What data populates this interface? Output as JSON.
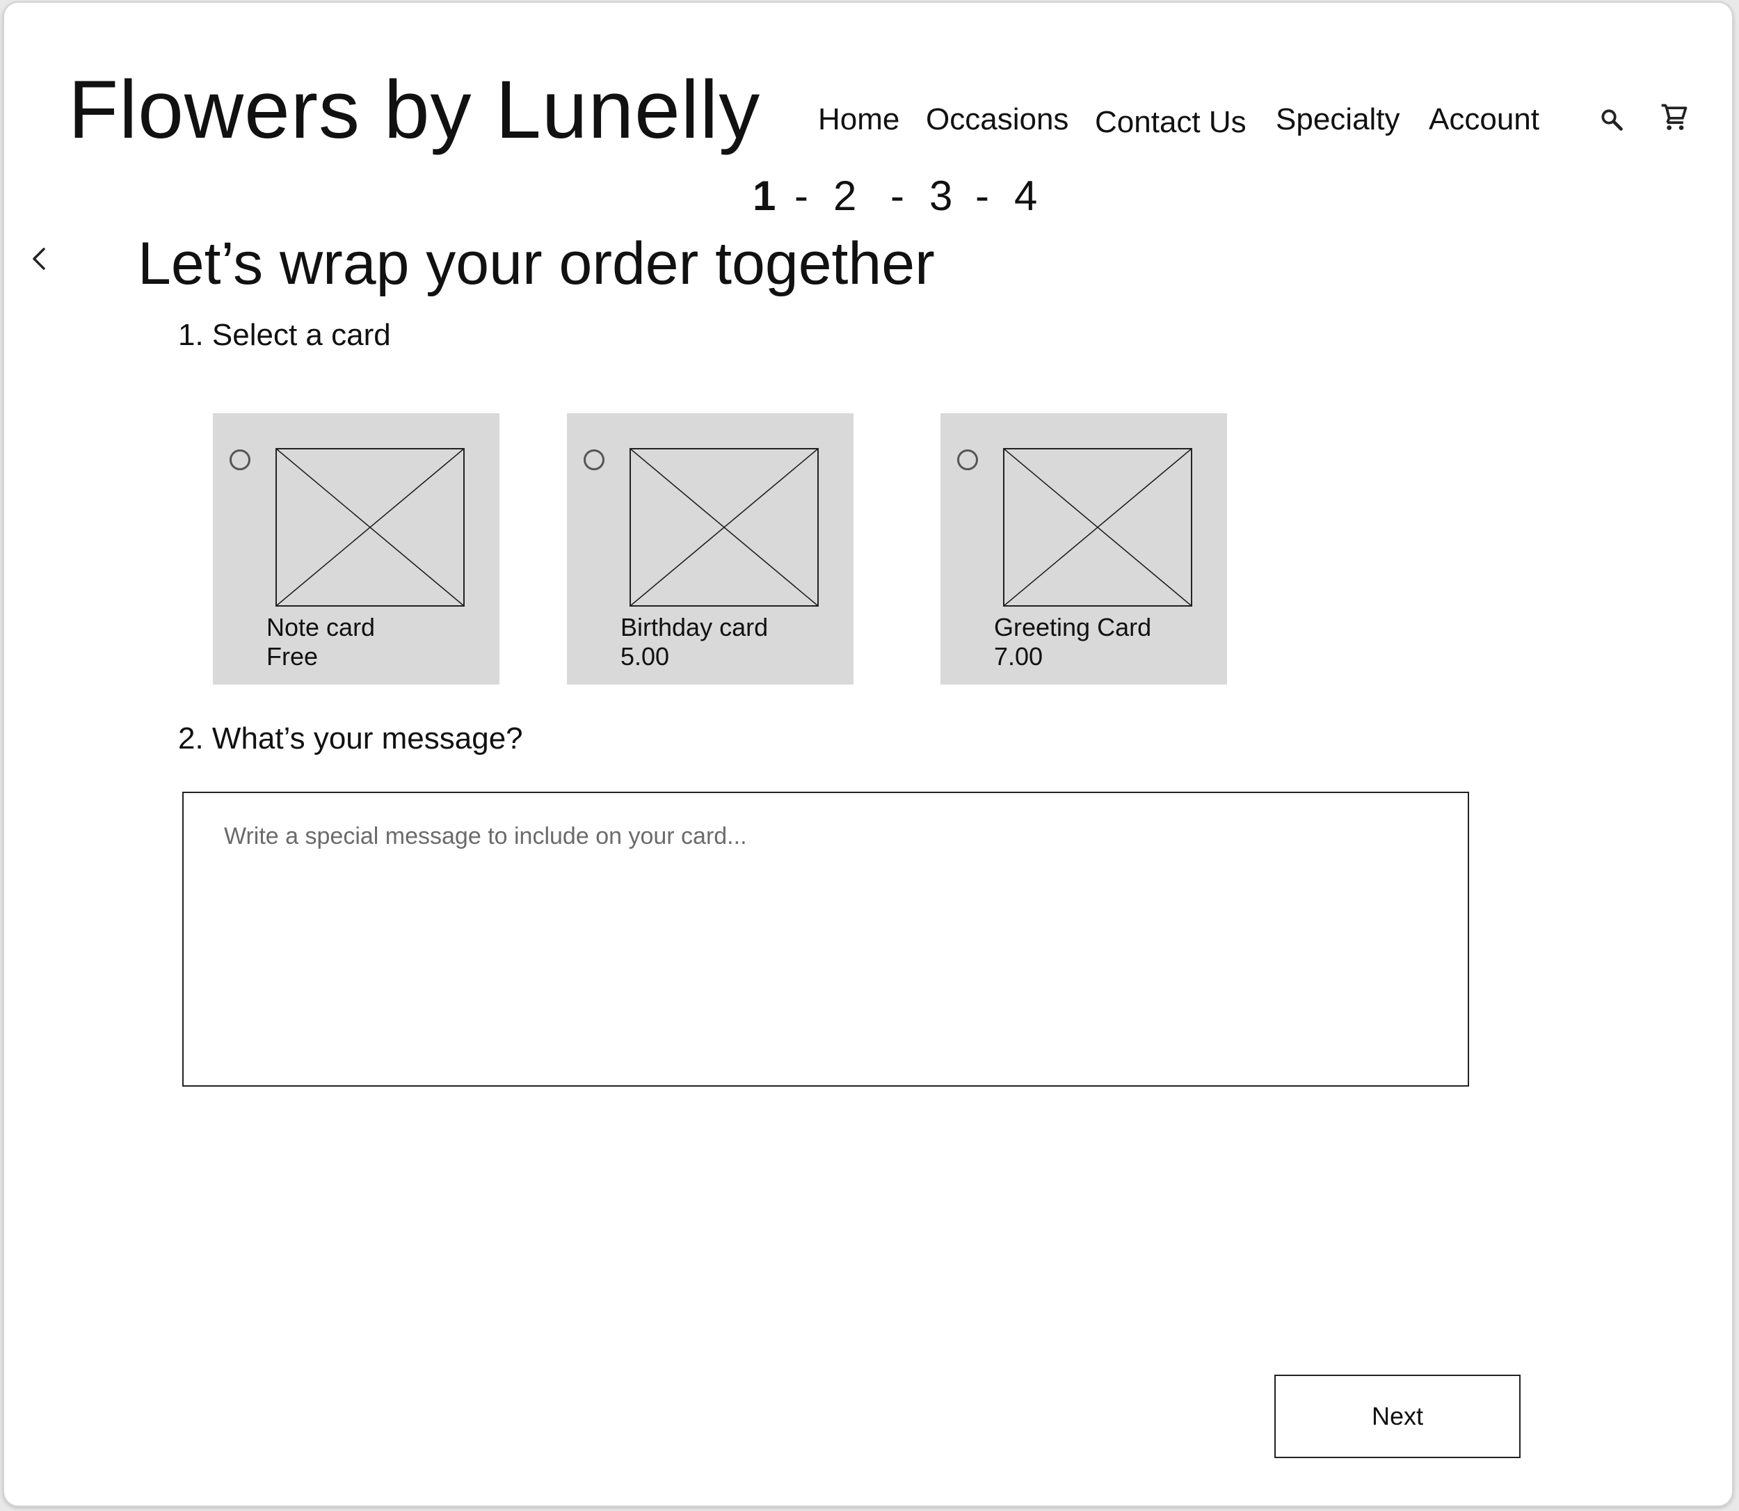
{
  "brand": {
    "title": "Flowers by Lunelly"
  },
  "nav": {
    "items": [
      {
        "label": "Home"
      },
      {
        "label": "Occasions"
      },
      {
        "label": "Contact Us"
      },
      {
        "label": "Specialty"
      },
      {
        "label": "Account"
      }
    ],
    "icons": [
      "search-icon",
      "cart-icon"
    ]
  },
  "progress": {
    "steps": [
      "1",
      "2",
      "3",
      "4"
    ],
    "separator": "-",
    "current_step": 1
  },
  "page": {
    "title": "Let’s wrap your order together"
  },
  "sections": {
    "select_card": {
      "label": "1. Select a card"
    },
    "message": {
      "label": "2. What’s your message?",
      "placeholder": "Write a special message to include on your card...",
      "value": ""
    }
  },
  "cards": [
    {
      "name": "Note card",
      "price": "Free",
      "selected": false
    },
    {
      "name": "Birthday card",
      "price": "5.00",
      "selected": false
    },
    {
      "name": "Greeting Card",
      "price": "7.00",
      "selected": false
    }
  ],
  "actions": {
    "next_label": "Next"
  },
  "colors": {
    "card_background": "#d9d9d9",
    "text": "#111111",
    "placeholder": "#6b6b6b",
    "border": "#222222"
  }
}
